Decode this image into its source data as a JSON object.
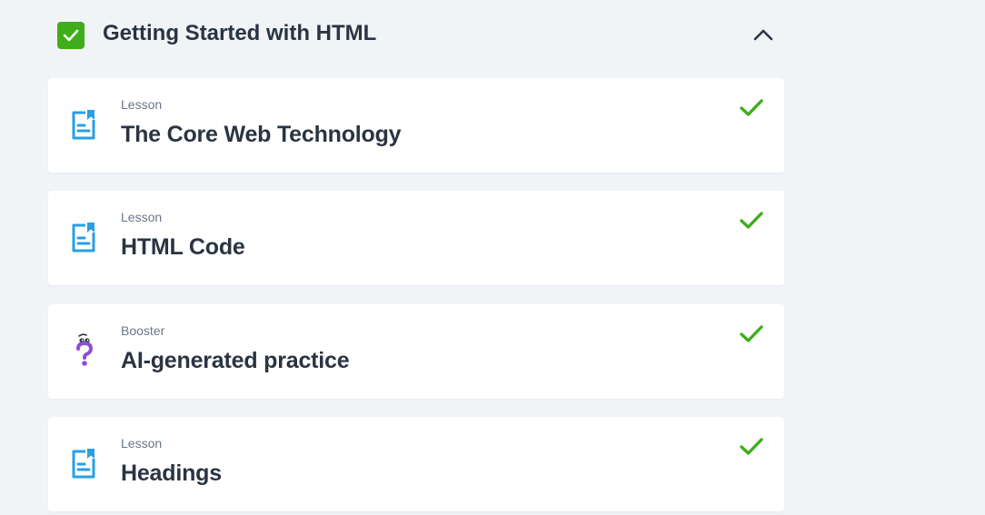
{
  "section": {
    "title": "Getting Started with HTML",
    "status": "completed",
    "expanded": true,
    "check_icon": "checkbox-checked-icon",
    "toggle_icon": "chevron-up-icon"
  },
  "colors": {
    "background": "#f1f4f7",
    "card": "#ffffff",
    "success": "#3fad1b",
    "lesson_icon": "#2a9fe3",
    "booster_icon": "#8a4fd6",
    "title_text": "#2a3442",
    "type_text": "#6a7787"
  },
  "items": [
    {
      "type": "Lesson",
      "title": "The Core Web Technology",
      "icon": "lesson-document-icon",
      "completed": true
    },
    {
      "type": "Lesson",
      "title": "HTML Code",
      "icon": "lesson-document-icon",
      "completed": true
    },
    {
      "type": "Booster",
      "title": "AI-generated practice",
      "icon": "question-mark-icon",
      "completed": true
    },
    {
      "type": "Lesson",
      "title": "Headings",
      "icon": "lesson-document-icon",
      "completed": true
    }
  ]
}
